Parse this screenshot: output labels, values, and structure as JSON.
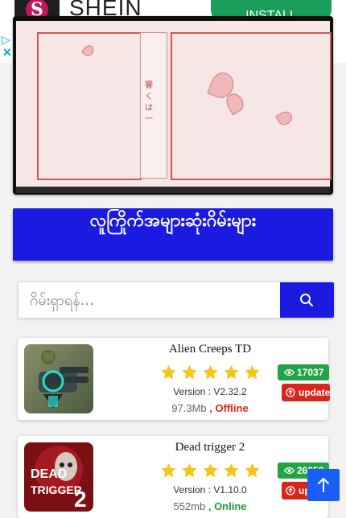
{
  "ad": {
    "brand": "SHEIN",
    "install_label": "INSTALL",
    "logo_letter": "S"
  },
  "banner": {
    "vertical_text": "響くは一"
  },
  "title": "လူကြိုက်အများဆုံးဂိမ်းများ",
  "search": {
    "placeholder": "ဂိမ်းရှာရန်..."
  },
  "games": [
    {
      "name": "Alien Creeps TD",
      "rating": 5,
      "version": "Version : V2.32.2",
      "size": "97.3Mb",
      "separator": " , ",
      "status": "Offline",
      "views": "17037",
      "update_label": "update"
    },
    {
      "name": "Dead trigger 2",
      "rating": 5,
      "version": "Version : V1.10.0",
      "size": "552mb",
      "separator": " , ",
      "status": "Online",
      "views": "26659",
      "update_label": "update",
      "thumb_text": "DEAD TRIGGER 2"
    }
  ],
  "colors": {
    "primary": "#1a1ae0",
    "star": "#f5c518",
    "views": "#23a347",
    "update": "#d9261c",
    "online": "#1a9e3a",
    "offline": "#d9261c",
    "top_button": "#1a5ef5"
  },
  "icons": {
    "search": "magnifier",
    "views": "eye",
    "update": "arrow-up-circle",
    "top": "arrow-up",
    "ad_play": "play-triangle",
    "ad_close": "close-x"
  }
}
